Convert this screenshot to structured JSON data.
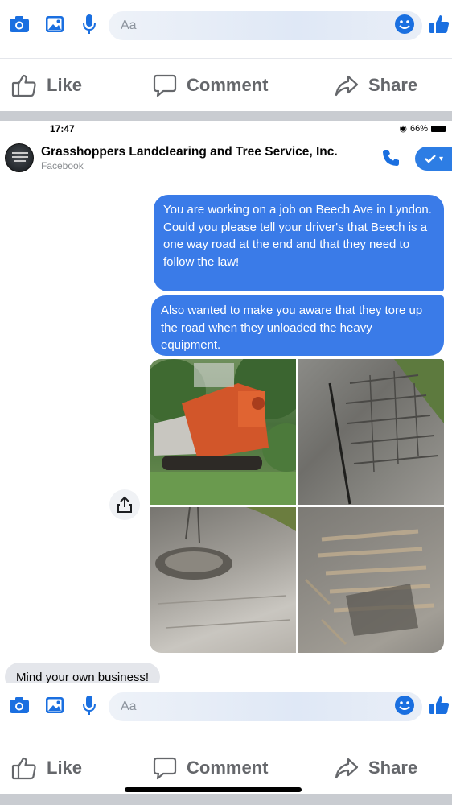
{
  "composer": {
    "placeholder": "Aa"
  },
  "actions": {
    "like": "Like",
    "comment": "Comment",
    "share": "Share"
  },
  "status": {
    "time": "17:47",
    "battery": "66%"
  },
  "chat": {
    "name": "Grasshoppers Landclearing and Tree Service, Inc.",
    "subtitle": "Facebook"
  },
  "messages": [
    {
      "text": "You are working on a job on Beech Ave in Lyndon.\nCould you please tell your driver's that Beech is a one way road at the end and that they need to follow the law!"
    },
    {
      "text": "Also wanted to make you aware that they tore up the road when they unloaded the heavy equipment."
    }
  ],
  "reply": {
    "text": "Mind your own business!"
  },
  "colors": {
    "messenger_blue": "#3a7be8",
    "icon_blue": "#1a6fe0",
    "action_gray": "#65676b"
  },
  "icons": [
    "camera-icon",
    "photo-icon",
    "microphone-icon",
    "emoji-icon",
    "thumbs-up-icon",
    "phone-icon",
    "check-icon",
    "share-icon"
  ]
}
